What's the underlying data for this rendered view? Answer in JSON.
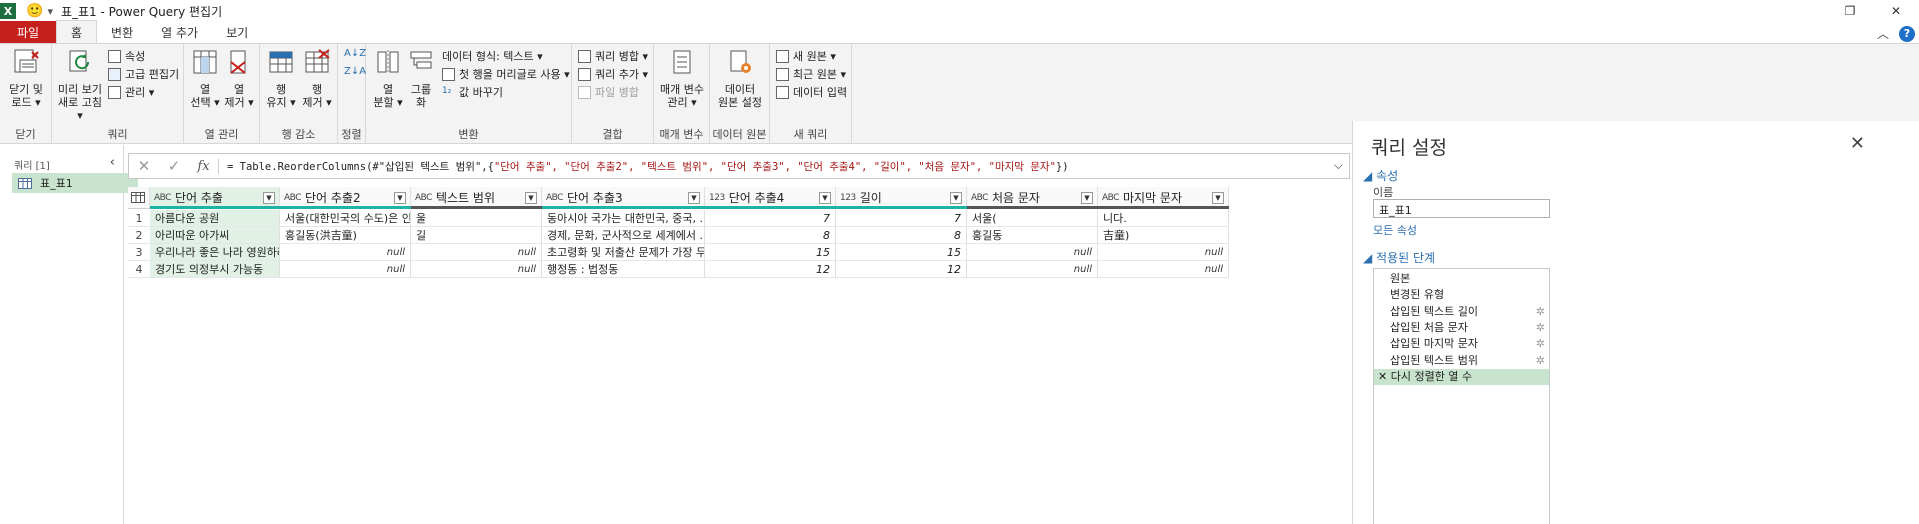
{
  "titlebar": {
    "app_icon": "X",
    "smiley": "🙂",
    "qa_dropdown": "▾",
    "title": "표_표1 - Power Query 편집기",
    "restore_icon": "❐",
    "close_icon": "✕"
  },
  "tabs": [
    {
      "label": "파일"
    },
    {
      "label": "홈"
    },
    {
      "label": "변환"
    },
    {
      "label": "열 추가"
    },
    {
      "label": "보기"
    }
  ],
  "tab_right": {
    "collapse_icon": "︿",
    "help_icon": "?"
  },
  "ribbon": {
    "groups": {
      "close": "닫기",
      "query": "쿼리",
      "manage_cols": "열 관리",
      "reduce_rows": "행 감소",
      "sort": "정렬",
      "transform": "변환",
      "combine": "결합",
      "params": "매개 변수",
      "datasource": "데이터 원본",
      "newquery": "새 쿼리"
    },
    "close_load": [
      "닫기 및",
      "로드 ▾"
    ],
    "refresh_preview": [
      "미리 보기",
      "새로 고침 ▾"
    ],
    "properties": "속성",
    "advanced_editor": "고급 편집기",
    "manage": "관리 ▾",
    "choose_columns": [
      "열",
      "선택 ▾"
    ],
    "remove_columns": [
      "열",
      "제거 ▾"
    ],
    "keep_rows": [
      "행",
      "유지 ▾"
    ],
    "remove_rows": [
      "행",
      "제거 ▾"
    ],
    "split_column": [
      "열",
      "분할 ▾"
    ],
    "group_by": "그룹화",
    "data_type": "데이터 형식: 텍스트 ▾",
    "first_row_headers": "첫 행을 머리글로 사용 ▾",
    "replace_values": "값 바꾸기",
    "merge_queries": "쿼리 병합 ▾",
    "append_queries": "쿼리 추가 ▾",
    "combine_files": "파일 병합",
    "manage_params": [
      "매개 변수",
      "관리 ▾"
    ],
    "datasource_settings": [
      "데이터",
      "원본 설정"
    ],
    "new_source": "새 원본 ▾",
    "recent_sources": "최근 원본 ▾",
    "enter_data": "데이터 입력"
  },
  "queries_panel": {
    "title": "쿼리 [1]",
    "collapse": "‹",
    "items": [
      {
        "label": "표_표1"
      }
    ]
  },
  "formula_bar": {
    "cancel": "✕",
    "confirm": "✓",
    "fx": "fx",
    "prefix": "= Table.ReorderColumns(#\"삽입된 텍스트 범위\",{",
    "args": "\"단어 추출\", \"단어 추출2\", \"텍스트 범위\", \"단어 추출3\", \"단어 추출4\", \"길이\", \"처음 문자\", \"마지막 문자\"",
    "suffix": "})",
    "expand": "⌵"
  },
  "grid": {
    "columns": [
      {
        "type": "ABC",
        "name": "단어 추출",
        "bar": "#1fb3a6"
      },
      {
        "type": "ABC",
        "name": "단어 추출2",
        "bar": "#1fb3a6"
      },
      {
        "type": "ABC",
        "name": "텍스트 범위",
        "bar": "#555555"
      },
      {
        "type": "ABC",
        "name": "단어 추출3",
        "bar": "#1fb3a6"
      },
      {
        "type": "123",
        "name": "단어 추출4",
        "bar": "#1fb3a6"
      },
      {
        "type": "123",
        "name": "길이",
        "bar": "#1fb3a6"
      },
      {
        "type": "ABC",
        "name": "처음 문자",
        "bar": "#555555"
      },
      {
        "type": "ABC",
        "name": "마지막 문자",
        "bar": "#555555"
      }
    ],
    "rows": [
      [
        "1",
        "아름다운 공원",
        "서울(대한민국의 수도)은 인...",
        "울",
        "동아시아 국가는 대한민국, 중국, ...",
        "7",
        "7",
        "서울(",
        "니다."
      ],
      [
        "2",
        "아리따운 아가씨",
        "홍길동(洪吉童)",
        "길",
        "경제, 문화, 군사적으로 세계에서 ...",
        "8",
        "8",
        "홍길동",
        "吉童)"
      ],
      [
        "3",
        "우리나라 좋은 나라 영원하라",
        "null",
        "null",
        "초고령화 및 저출산 문제가 가장 두...",
        "15",
        "15",
        "null",
        "null"
      ],
      [
        "4",
        "경기도 의정부시 가능동",
        "null",
        "null",
        "행정동 : 법정동",
        "12",
        "12",
        "null",
        "null"
      ]
    ]
  },
  "settings": {
    "title": "쿼리 설정",
    "close": "✕",
    "properties_header": "속성",
    "name_label": "이름",
    "name_value": "표_표1",
    "all_properties": "모든 속성",
    "steps_header": "적용된 단계",
    "steps": [
      {
        "label": "원본",
        "gear": ""
      },
      {
        "label": "변경된 유형",
        "gear": ""
      },
      {
        "label": "삽입된 텍스트 길이",
        "gear": "✲"
      },
      {
        "label": "삽입된 처음 문자",
        "gear": "✲"
      },
      {
        "label": "삽입된 마지막 문자",
        "gear": "✲"
      },
      {
        "label": "삽입된 텍스트 범위",
        "gear": "✲"
      },
      {
        "label": "✕ 다시 정렬한 열 수",
        "gear": ""
      }
    ]
  }
}
